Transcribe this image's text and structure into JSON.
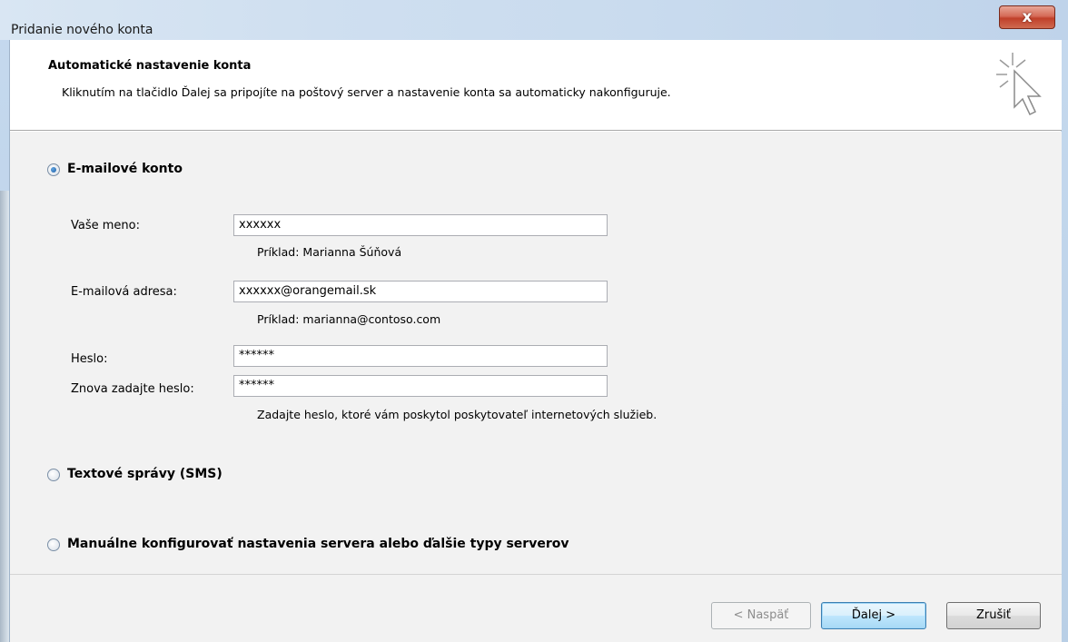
{
  "window": {
    "title": "Pridanie nového konta",
    "close_glyph": "x"
  },
  "header": {
    "title": "Automatické nastavenie konta",
    "description": "Kliknutím na tlačidlo Ďalej sa pripojíte na poštový server a nastavenie konta sa automaticky nakonfiguruje.",
    "icon": "cursor-sparkle-icon"
  },
  "options": {
    "email_account": {
      "label": "E-mailové konto",
      "selected": true
    },
    "sms": {
      "label": "Textové správy (SMS)",
      "selected": false
    },
    "manual": {
      "label": "Manuálne konfigurovať nastavenia servera alebo ďalšie typy serverov",
      "selected": false
    }
  },
  "form": {
    "name": {
      "label": "Vaše meno:",
      "value": "xxxxxx",
      "hint": "Príklad: Marianna Šúňová"
    },
    "email": {
      "label": "E-mailová adresa:",
      "value": "xxxxxx@orangemail.sk",
      "hint": "Príklad: marianna@contoso.com"
    },
    "password": {
      "label": "Heslo:",
      "value": "******"
    },
    "password_repeat": {
      "label": "Znova zadajte heslo:",
      "value": "******",
      "hint": "Zadajte heslo, ktoré vám poskytol poskytovateľ internetových služieb."
    }
  },
  "buttons": {
    "back": "< Naspäť",
    "next": "Ďalej >",
    "cancel": "Zrušiť"
  }
}
